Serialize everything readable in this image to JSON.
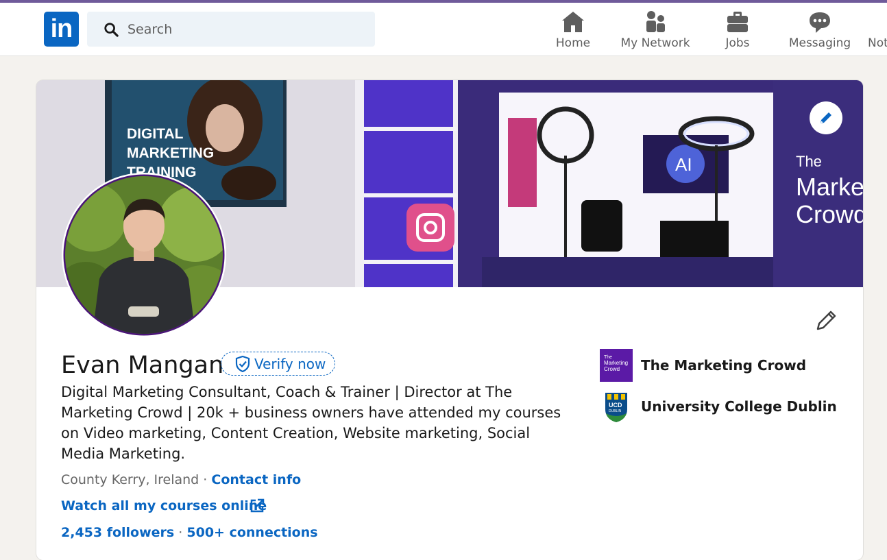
{
  "nav": {
    "logo_text": "in",
    "search": {
      "placeholder": "Search",
      "value": ""
    },
    "items": [
      {
        "label": "Home",
        "icon": "home-icon"
      },
      {
        "label": "My Network",
        "icon": "my-network-icon"
      },
      {
        "label": "Jobs",
        "icon": "briefcase-icon"
      },
      {
        "label": "Messaging",
        "icon": "messaging-icon"
      },
      {
        "label": "Not",
        "icon": "notifications-icon"
      }
    ]
  },
  "profile": {
    "banner_text": {
      "poster": [
        "DIGITAL",
        "MARKETING",
        "TRAINING"
      ],
      "wall_sign": [
        "The",
        "Market",
        "Crowd"
      ],
      "screen_text": "AI"
    },
    "name": "Evan Mangan",
    "verify_label": "Verify now",
    "headline": "Digital Marketing Consultant, Coach & Trainer | Director at The Marketing Crowd | 20k + business owners have attended my courses on Video marketing, Content Creation, Website marketing, Social Media Marketing.",
    "location": "County Kerry, Ireland",
    "separator": "·",
    "contact_info": "Contact info",
    "website_link": "Watch all my courses online",
    "followers": "2,453 followers",
    "connections_sep": "·",
    "connections": "500+ connections",
    "organizations": [
      {
        "name": "The Marketing Crowd",
        "logo_text": [
          "The",
          "Marketing",
          "Crowd"
        ]
      },
      {
        "name": "University College Dublin",
        "logo_text": [
          "UCD",
          "DUBLIN"
        ]
      }
    ]
  },
  "colors": {
    "brand_blue": "#0a66c2",
    "page_bg": "#f4f2ee",
    "org_purple": "#5b1aa6",
    "avatar_ring": "#4a1478"
  }
}
